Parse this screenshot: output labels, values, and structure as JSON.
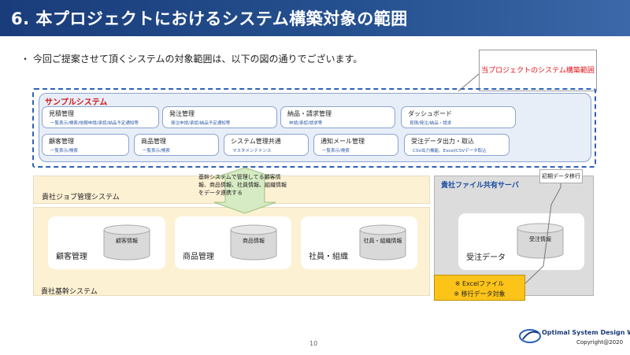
{
  "title": "6. 本プロジェクトにおけるシステム構築対象の範囲",
  "intro": "・ 今回ご提案させて頂くシステムの対象範囲は、以下の図の通りでございます。",
  "callout": "当プロジェクトのシステム構築範囲",
  "sample_system": {
    "title": "サンプルシステム",
    "modules": [
      {
        "title": "見積管理",
        "sub": "一覧表示/検索/依頼申請/承認/納品予定通知等"
      },
      {
        "title": "発注管理",
        "sub": "発注申請/承認/納品予定通知等"
      },
      {
        "title": "納品・請求管理",
        "sub": "申請/承認/請求等"
      },
      {
        "title": "ダッシュボード",
        "sub": "見積/発注/納品・請求"
      },
      {
        "title": "顧客管理",
        "sub": "一覧表示/検索"
      },
      {
        "title": "商品管理",
        "sub": "一覧表示/検索"
      },
      {
        "title": "システム管理共通",
        "sub": "マスタメンテナンス"
      },
      {
        "title": "通知メール管理",
        "sub": "一覧表示/検索"
      },
      {
        "title": "受注データ出力・取込",
        "sub": "CSV出力機能、Excel/CSVデータ取込"
      }
    ]
  },
  "job_system": "貴社ジョブ管理システム",
  "arrow_text": "基幹システムで管理してる顧客情報、商品情報、社員情報、組織情報をデータ連携する",
  "core_system": {
    "label": "貴社基幹システム",
    "cards": [
      {
        "label": "顧客管理",
        "db": "顧客情報"
      },
      {
        "label": "商品管理",
        "db": "商品情報"
      },
      {
        "label": "社員・組織",
        "db": "社員・組織情報"
      }
    ]
  },
  "file_server": {
    "title": "貴社ファイル共有サーバ",
    "card_label": "受注データ",
    "db": "受注情報"
  },
  "excel_note": {
    "line1": "※ Excelファイル",
    "line2": "※ 移行データ対象"
  },
  "migration_label": "初期データ移行",
  "page_number": "10",
  "company": "Optimal System Design Works",
  "copyright": "Copyright@2020",
  "colors": {
    "title_bar": "#1a3c7a",
    "accent_red": "#d0191c",
    "sample_bg": "#e8eef8",
    "core_bg": "#fdf1d4",
    "share_bg": "#dcdcdc",
    "excel_bg": "#fcc419",
    "arrow_green": "#d6ebc4"
  },
  "icons": [
    "database-icon",
    "company-logo-icon"
  ]
}
